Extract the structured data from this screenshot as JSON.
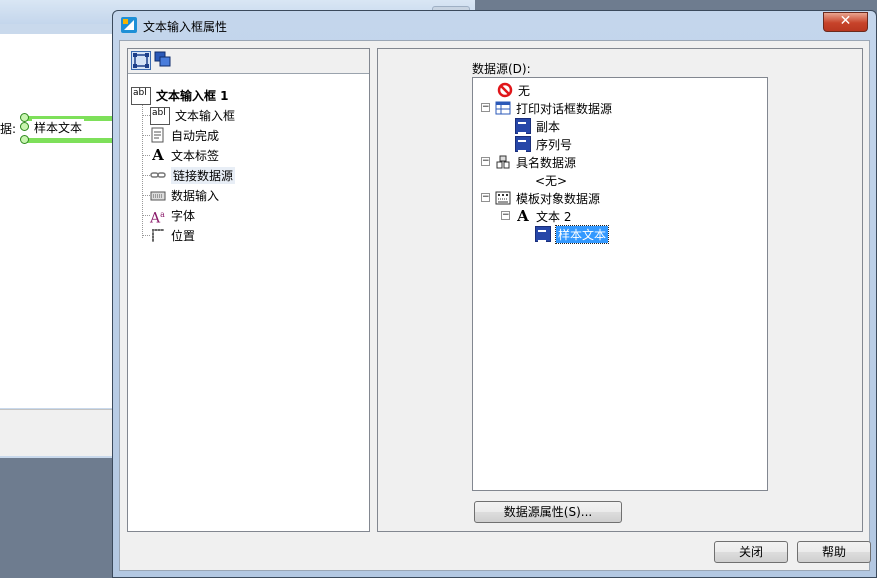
{
  "background": {
    "field_label": "据:",
    "field_text": "样本文本"
  },
  "dialog": {
    "title": "文本输入框属性",
    "close_glyph": "✕"
  },
  "left_tree": {
    "root": "文本输入框 1",
    "items": [
      {
        "label": "文本输入框",
        "icon": "text-box-icon"
      },
      {
        "label": "自动完成",
        "icon": "autocomplete-icon"
      },
      {
        "label": "文本标签",
        "icon": "text-label-icon"
      },
      {
        "label": "链接数据源",
        "icon": "link-icon"
      },
      {
        "label": "数据输入",
        "icon": "keyboard-icon"
      },
      {
        "label": "字体",
        "icon": "font-icon"
      },
      {
        "label": "位置",
        "icon": "position-icon"
      }
    ]
  },
  "data_source": {
    "label": "数据源(D):",
    "none": "无",
    "print_dialog": "打印对话框数据源",
    "copy": "副本",
    "serial": "序列号",
    "named": "具名数据源",
    "named_empty": "<无>",
    "template": "模板对象数据源",
    "text2": "文本 2",
    "sample": "样本文本"
  },
  "buttons": {
    "ds_properties": "数据源属性(S)...",
    "close": "关闭",
    "help": "帮助"
  }
}
